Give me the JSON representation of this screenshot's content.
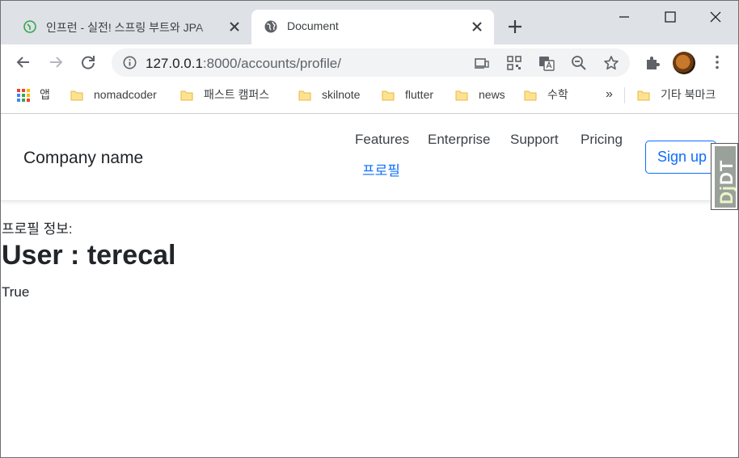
{
  "browser": {
    "tabs": [
      {
        "title": "인프런 - 실전! 스프링 부트와 JPA",
        "active": false,
        "icon": "inflearn-favicon"
      },
      {
        "title": "Document",
        "active": true,
        "icon": "globe-icon"
      }
    ],
    "url": {
      "host": "127.0.0.1",
      "path": ":8000/accounts/profile/"
    },
    "bookmarks": [
      {
        "label": "앱",
        "icon": "apps-grid-icon"
      },
      {
        "label": "nomadcoder",
        "icon": "folder-icon"
      },
      {
        "label": "패스트 캠퍼스",
        "icon": "folder-icon"
      },
      {
        "label": "skilnote",
        "icon": "folder-icon"
      },
      {
        "label": "flutter",
        "icon": "folder-icon"
      },
      {
        "label": "news",
        "icon": "folder-icon"
      },
      {
        "label": "수학",
        "icon": "folder-icon"
      },
      {
        "label": "»",
        "icon": "chevron-more-icon"
      },
      {
        "label": "기타 북마크",
        "icon": "folder-icon"
      }
    ]
  },
  "navbar": {
    "brand": "Company name",
    "links": [
      "Features",
      "Enterprise",
      "Support",
      "Pricing"
    ],
    "profile_link": "프로필",
    "signup": "Sign up",
    "debug_toolbar": {
      "dj": "Dj",
      "dt": "DT"
    }
  },
  "content": {
    "label": "프로필 정보:",
    "heading": "User : terecal",
    "value": "True"
  },
  "colors": {
    "accent": "#0d6efd",
    "tabstrip": "#dee1e6",
    "text": "#212529"
  }
}
